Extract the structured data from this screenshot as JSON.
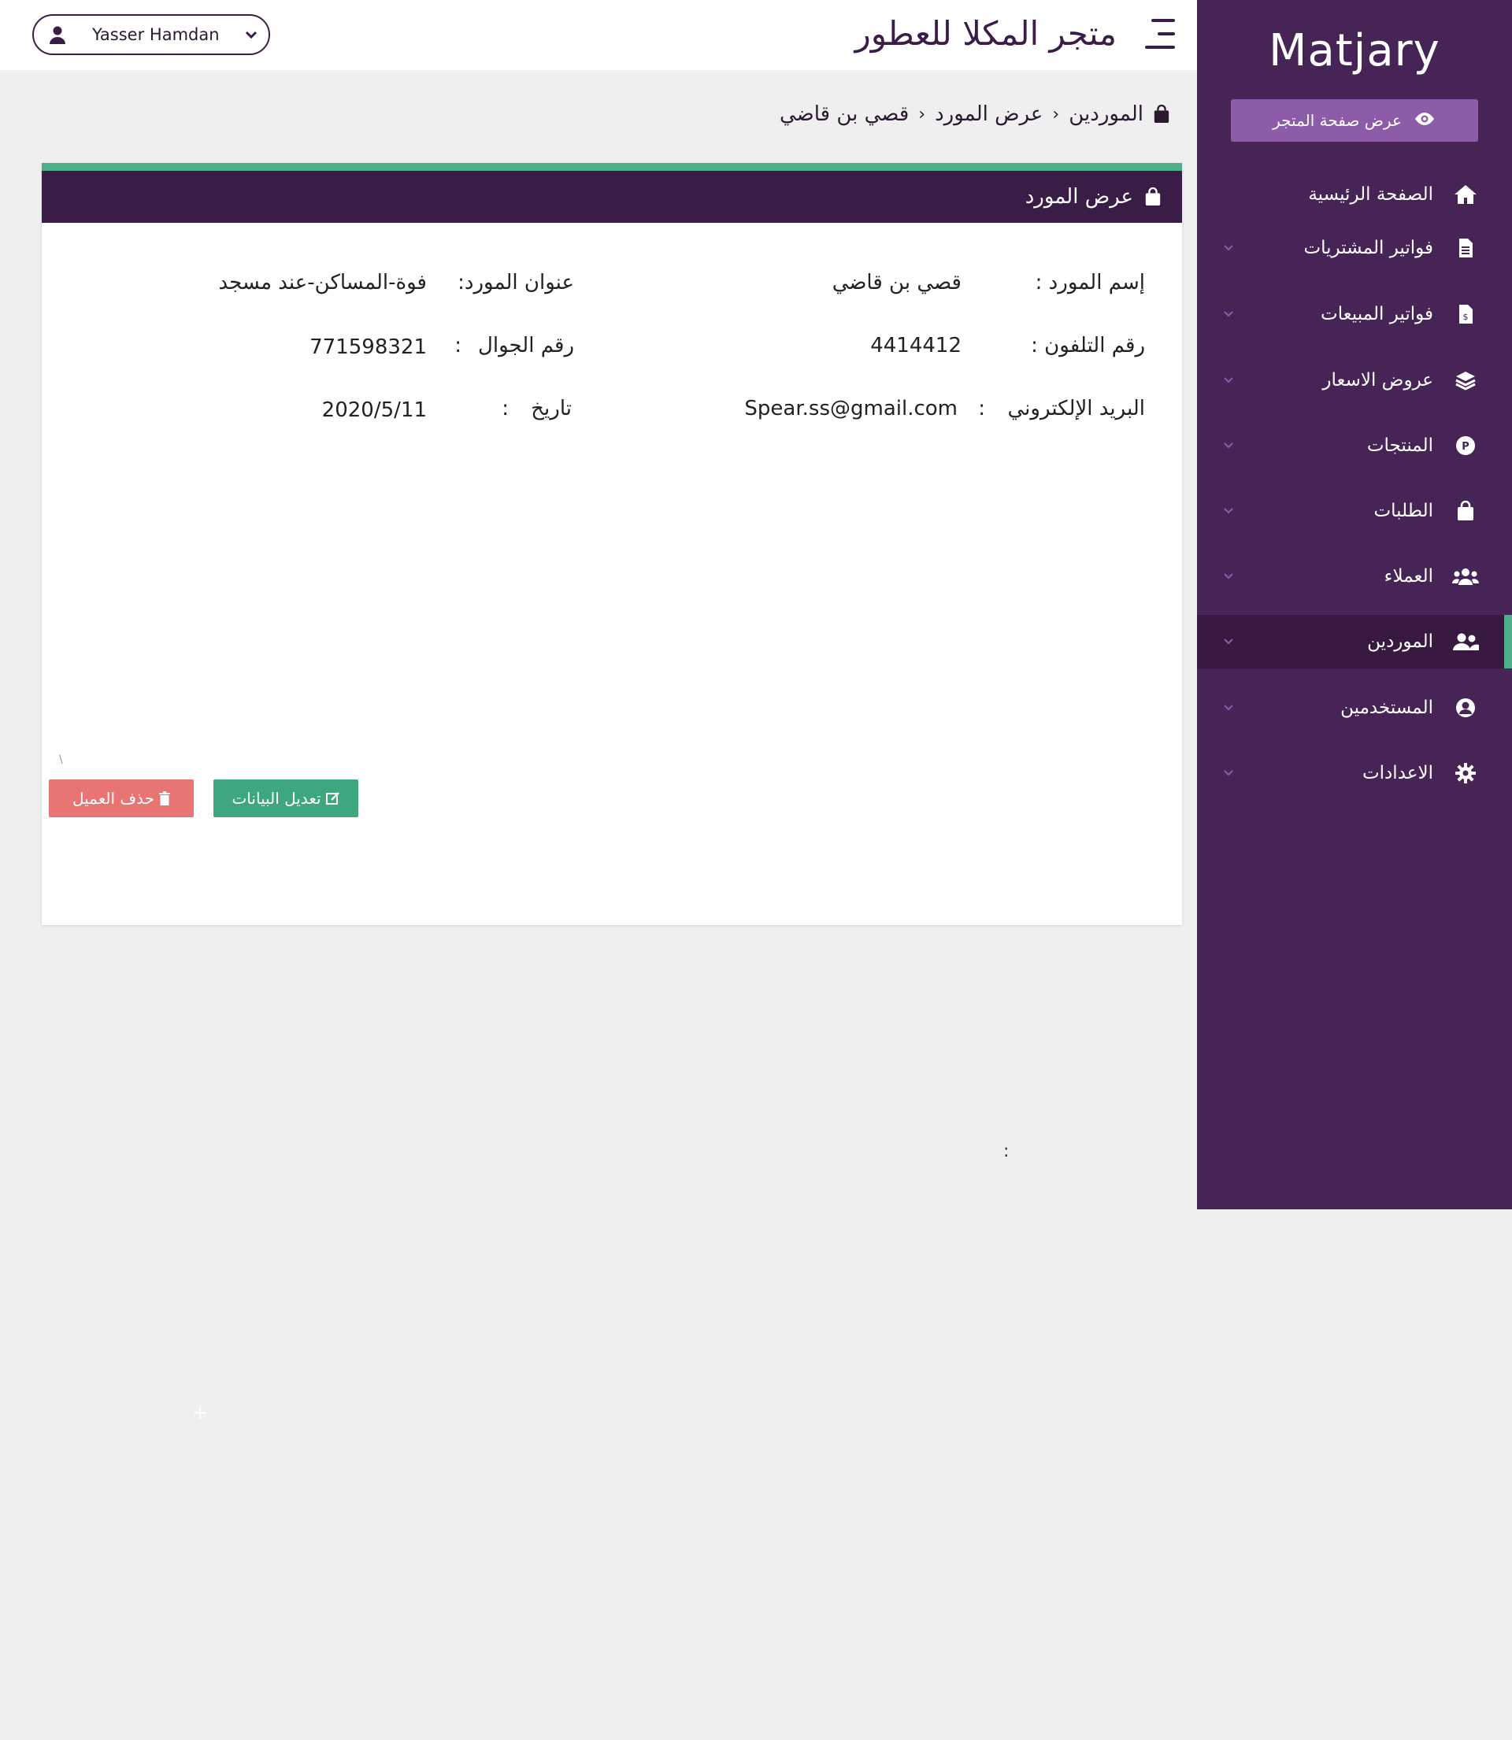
{
  "sidebar": {
    "brand": "Matjary",
    "view_store_label": "عرض صفحة المتجر",
    "items": [
      {
        "label": "الصفحة الرئيسية",
        "icon": "home-icon",
        "has_chevron": false
      },
      {
        "label": "فواتير المشتريات",
        "icon": "file-invoice-icon",
        "has_chevron": true
      },
      {
        "label": "فواتير المبيعات",
        "icon": "file-dollar-icon",
        "has_chevron": true
      },
      {
        "label": "عروض الاسعار",
        "icon": "layers-icon",
        "has_chevron": true
      },
      {
        "label": "المنتجات",
        "icon": "product-p-icon",
        "has_chevron": true
      },
      {
        "label": "الطلبات",
        "icon": "shopping-bag-icon",
        "has_chevron": true
      },
      {
        "label": "العملاء",
        "icon": "users-icon",
        "has_chevron": true
      },
      {
        "label": "الموردين",
        "icon": "user-friends-icon",
        "has_chevron": true,
        "active": true
      },
      {
        "label": "المستخدمين",
        "icon": "user-circle-icon",
        "has_chevron": true
      },
      {
        "label": "الاعدادات",
        "icon": "cog-icon",
        "has_chevron": true
      }
    ]
  },
  "header": {
    "store_title": "متجر المكلا للعطور",
    "user_name": "Yasser Hamdan"
  },
  "breadcrumb": {
    "items": [
      "الموردين",
      "عرض المورد",
      "قصي بن قاضي"
    ]
  },
  "card": {
    "title": "عرض المورد",
    "fields": {
      "name_label": "إسم المورد :",
      "name_value": "قصي بن قاضي",
      "address_label": "عنوان المورد:",
      "address_value": "فوة-المساكن-عند مسجد",
      "phone_label": "رقم التلفون :",
      "phone_value": "4414412",
      "mobile_label": "رقم الجوال",
      "mobile_value": "771598321",
      "email_label": "البريد الإلكتروني",
      "email_value": "Spear.ss@gmail.com",
      "date_label": "تاريخ",
      "date_value": "2020/5/11",
      "colon": ":"
    },
    "edit_button": "تعديل البيانات",
    "delete_button": "حذف العميل"
  },
  "stray": {
    "colon": ":",
    "plus": "+",
    "mark": "\\"
  },
  "colors": {
    "sidebar_bg": "#472456",
    "header_bg": "#3a1d47",
    "accent_green": "#4caf88",
    "delete_red": "#e87474",
    "store_btn": "#8d5ca8"
  }
}
